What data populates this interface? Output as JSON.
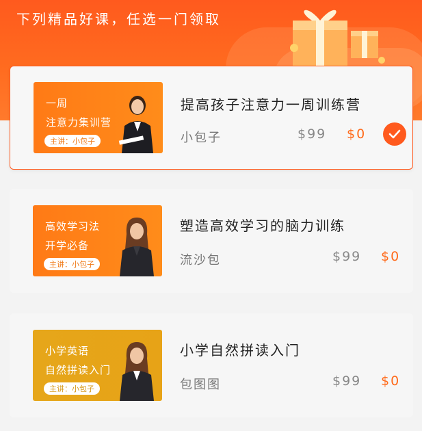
{
  "banner": {
    "title": "下列精品好课，任选一门领取",
    "gift_icon": "gift-box-icon"
  },
  "courses": [
    {
      "thumb_line1": "一周",
      "thumb_line2": "注意力集训营",
      "lecturer": "主讲：小包子",
      "title": "提高孩子注意力一周训练营",
      "author": "小包子",
      "price_old": "$99",
      "price_new": "$0",
      "selected": true,
      "thumb_color": "#ff7a16"
    },
    {
      "thumb_line1": "高效学习法",
      "thumb_line2": "开学必备",
      "lecturer": "主讲：小包子",
      "title": "塑造高效学习的脑力训练",
      "author": "流沙包",
      "price_old": "$99",
      "price_new": "$0",
      "selected": false,
      "thumb_color": "#ff7a16"
    },
    {
      "thumb_line1": "小学英语",
      "thumb_line2": "自然拼读入门",
      "lecturer": "主讲：小包子",
      "title": "小学自然拼读入门",
      "author": "包图图",
      "price_old": "$99",
      "price_new": "$0",
      "selected": false,
      "thumb_color": "#e6a61a"
    }
  ],
  "colors": {
    "accent": "#ff5a1e",
    "price_new": "#ff6a1a"
  }
}
